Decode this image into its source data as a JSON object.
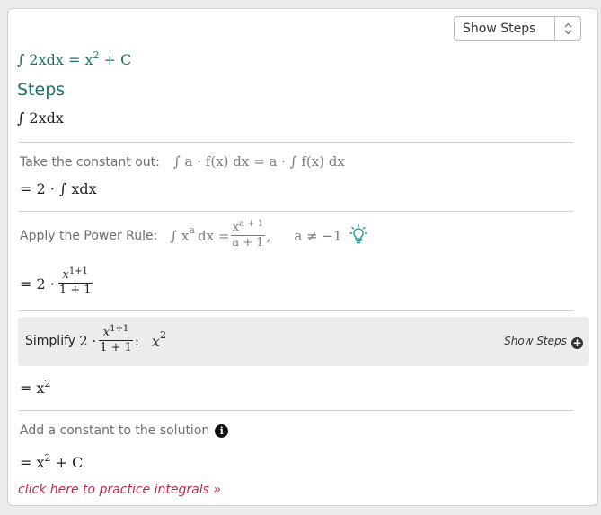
{
  "header": {
    "select_label": "Show Steps",
    "result": {
      "integral": "∫ 2xdx",
      "equals": "= x",
      "exp": "2",
      "tail": " + C"
    },
    "steps_title": "Steps"
  },
  "problem": "∫ 2xdx",
  "step1": {
    "label": "Take the constant out:",
    "rule": "∫ a · f(x) dx = a · ∫ f(x) dx",
    "result": "= 2 · ∫ xdx"
  },
  "step2": {
    "label": "Apply the Power Rule:",
    "rule_lhs": "∫ x",
    "rule_lhs_exp": "a",
    "rule_dx": "dx =",
    "rule_num": "x",
    "rule_num_exp": "a + 1",
    "rule_den": "a + 1",
    "rule_cond": "a ≠ −1",
    "result_prefix": "= 2 ·",
    "result_num": "x",
    "result_num_exp": "1+1",
    "result_den": "1 + 1"
  },
  "step3": {
    "label": "Simplify",
    "prefix": "2 ·",
    "num": "x",
    "num_exp": "1+1",
    "den": "1 + 1",
    "colon": ":",
    "answer": "x",
    "answer_exp": "2",
    "show_steps": "Show Steps",
    "result": "= x",
    "result_exp": "2"
  },
  "step4": {
    "label": "Add a constant to the solution",
    "result": "= x",
    "result_exp": "2",
    "result_tail": " + C"
  },
  "practice_link": "click here to practice integrals »",
  "colors": {
    "teal": "#1f6f68",
    "link": "#c2284a",
    "lightbulb": "#2a9a9e"
  },
  "icons": [
    "chevron-updown-icon",
    "lightbulb-icon",
    "plus-circle-icon",
    "info-icon"
  ]
}
